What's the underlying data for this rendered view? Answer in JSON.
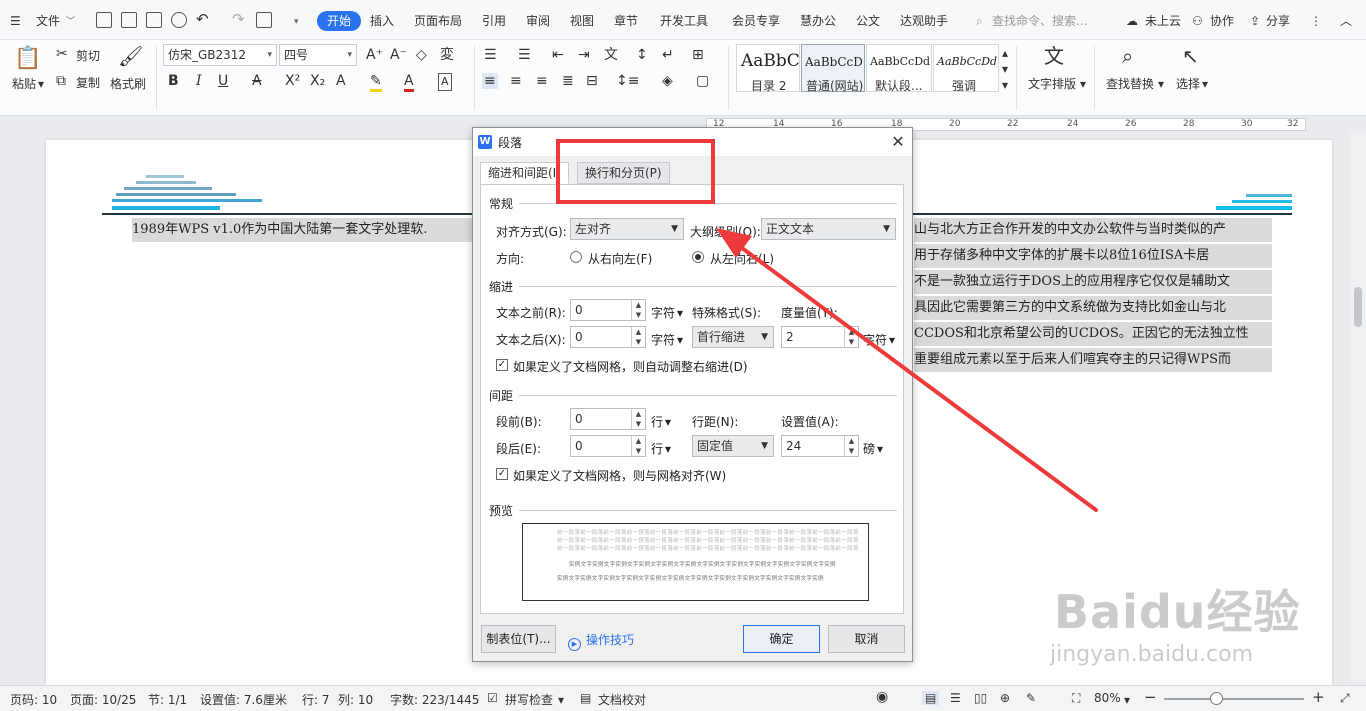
{
  "menubar": {
    "file": "文件",
    "tabs": [
      "开始",
      "插入",
      "页面布局",
      "引用",
      "审阅",
      "视图",
      "章节",
      "开发工具",
      "会员专享",
      "慧办公",
      "公文",
      "达观助手"
    ],
    "active_tab": "开始",
    "search_placeholder": "查找命令、搜索...",
    "cloud": "未上云",
    "collab": "协作",
    "share": "分享"
  },
  "ribbon": {
    "paste": "粘贴",
    "cut": "剪切",
    "copy": "复制",
    "format_painter": "格式刷",
    "font_name": "仿宋_GB2312",
    "font_size": "四号",
    "styles": [
      {
        "sample": "AaBbC",
        "name": "目录 2"
      },
      {
        "sample": "AaBbCcD",
        "name": "普通(网站)"
      },
      {
        "sample": "AaBbCcDd",
        "name": "默认段..."
      },
      {
        "sample": "AaBbCcDd",
        "name": "强调"
      }
    ],
    "text_layout": "文字排版",
    "find_replace": "查找替换",
    "select": "选择"
  },
  "ruler": {
    "ticks": [
      "12",
      "14",
      "16",
      "18",
      "20",
      "22",
      "24",
      "26",
      "28",
      "30",
      "32"
    ]
  },
  "document": {
    "lines_left": [
      "1989年WPS v1.0作为中国大陆第一套文字处理软."
    ],
    "lines_right": [
      "山与北大方正合作开发的中文办公软件与当时类似的产",
      "用于存储多种中文字体的扩展卡以8位16位ISA卡居",
      "不是一款独立运行于DOS上的应用程序它仅仅是辅助文",
      "具因此它需要第三方的中文系统做为支持比如金山与北",
      "CCDOS和北京希望公司的UCDOS。正因它的无法独立性",
      "重要组成元素以至于后来人们喧宾夺主的只记得WPS而"
    ]
  },
  "dialog": {
    "title": "段落",
    "tab_indent": "缩进和间距(I)",
    "tab_linebreak": "换行和分页(P)",
    "general": "常规",
    "alignment_label": "对齐方式(G):",
    "alignment_value": "左对齐",
    "outline_label": "大纲级别(O):",
    "outline_value": "正文文本",
    "direction_label": "方向:",
    "rtl": "从右向左(F)",
    "ltr": "从左向右(L)",
    "indent": "缩进",
    "before_text_label": "文本之前(R):",
    "before_text_value": "0",
    "after_text_label": "文本之后(X):",
    "after_text_value": "0",
    "unit_char": "字符",
    "special_label": "特殊格式(S):",
    "special_value": "首行缩进",
    "measure_label": "度量值(Y):",
    "measure_value": "2",
    "auto_right_indent": "如果定义了文档网格，则自动调整右缩进(D)",
    "spacing": "间距",
    "before_label": "段前(B):",
    "before_value": "0",
    "after_label": "段后(E):",
    "after_value": "0",
    "unit_line": "行",
    "line_spacing_label": "行距(N):",
    "line_spacing_value": "固定值",
    "setting_label": "设置值(A):",
    "setting_value": "24",
    "unit_pound": "磅",
    "snap_grid": "如果定义了文档网格，则与网格对齐(W)",
    "preview": "预览",
    "preview_prev": "前一段落前一段落前一段落前一段落前一段落前一段落前一段落前一段落前一段落前一段落前一段落前一段落前一段落",
    "preview_sample": "实例文字实例文字实例文字实例文字实例文字实例文字实例文字实例文字实例文字实例文字实例文字实例",
    "tab_stops": "制表位(T)...",
    "tips": "操作技巧",
    "ok": "确定",
    "cancel": "取消"
  },
  "statusbar": {
    "page_no": "页码: 10",
    "pages": "页面: 10/25",
    "section": "节: 1/1",
    "setting": "设置值: 7.6厘米",
    "row": "行: 7",
    "col": "列: 10",
    "words": "字数: 223/1445",
    "spell": "拼写检查",
    "proof": "文档校对",
    "zoom": "80%"
  },
  "watermark": {
    "brand": "Baidu经验",
    "url": "jingyan.baidu.com"
  },
  "colors": {
    "accent": "#2a73ee",
    "annotation": "#ee3a3a"
  }
}
